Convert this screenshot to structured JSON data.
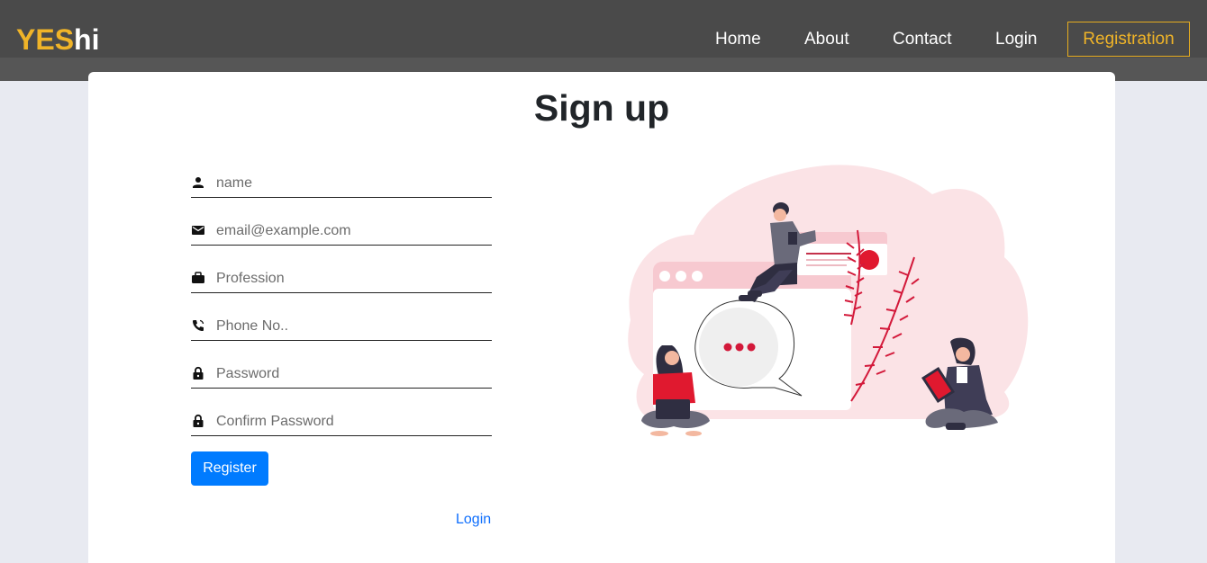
{
  "navbar": {
    "brand_part1": "YES",
    "brand_part2": "hi",
    "links": [
      "Home",
      "About",
      "Contact",
      "Login"
    ],
    "registration_label": "Registration",
    "brand_color": "#f0b428",
    "bg_color": "#4a4a4a"
  },
  "main": {
    "title": "Sign up",
    "fields": [
      {
        "icon": "person-icon",
        "placeholder": "name"
      },
      {
        "icon": "envelope-icon",
        "placeholder": "email@example.com"
      },
      {
        "icon": "briefcase-icon",
        "placeholder": "Profession"
      },
      {
        "icon": "phone-icon",
        "placeholder": "Phone No.."
      },
      {
        "icon": "lock-icon",
        "placeholder": "Password"
      },
      {
        "icon": "lock-icon",
        "placeholder": "Confirm Password"
      }
    ],
    "register_label": "Register",
    "login_link": "Login",
    "accent": "#007bff"
  }
}
